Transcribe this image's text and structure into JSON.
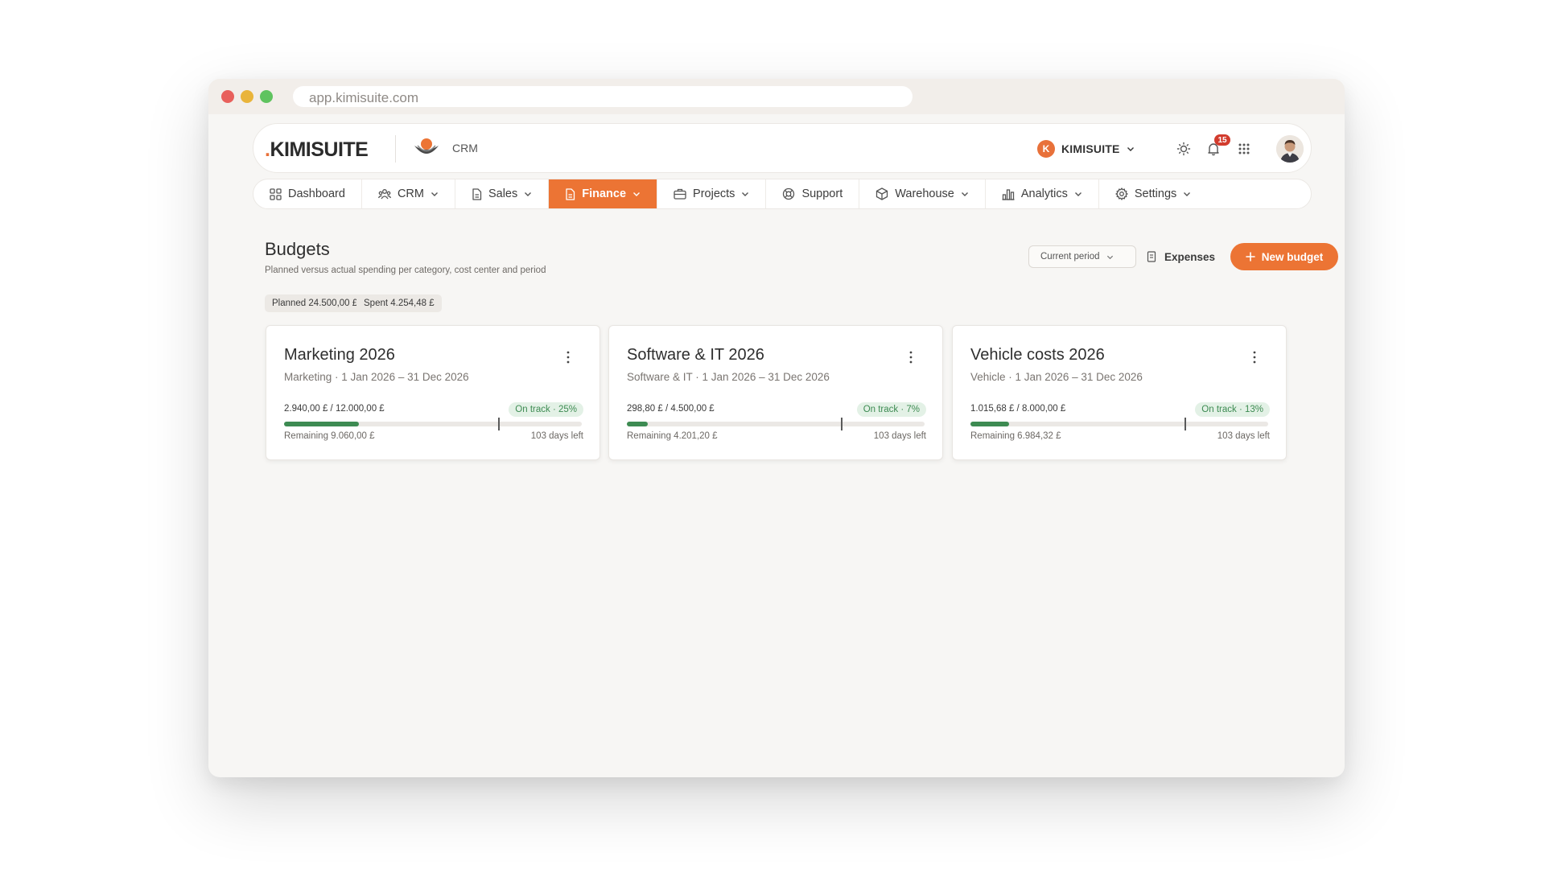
{
  "browser": {
    "url": "app.kimisuite.com"
  },
  "topbar": {
    "logo_text": "KIMISUITE",
    "app_label": "CRM",
    "org_initial": "K",
    "org_name": "KIMISUITE",
    "notifications_count": "15"
  },
  "nav": {
    "items": [
      {
        "label": "Dashboard",
        "icon": "grid-icon",
        "dropdown": false,
        "active": false
      },
      {
        "label": "CRM",
        "icon": "users-icon",
        "dropdown": true,
        "active": false
      },
      {
        "label": "Sales",
        "icon": "document-icon",
        "dropdown": true,
        "active": false
      },
      {
        "label": "Finance",
        "icon": "document-icon",
        "dropdown": true,
        "active": true
      },
      {
        "label": "Projects",
        "icon": "briefcase-icon",
        "dropdown": true,
        "active": false
      },
      {
        "label": "Support",
        "icon": "lifebuoy-icon",
        "dropdown": false,
        "active": false
      },
      {
        "label": "Warehouse",
        "icon": "box-icon",
        "dropdown": true,
        "active": false
      },
      {
        "label": "Analytics",
        "icon": "bar-chart-icon",
        "dropdown": true,
        "active": false
      },
      {
        "label": "Settings",
        "icon": "gear-icon",
        "dropdown": true,
        "active": false
      }
    ]
  },
  "page": {
    "title": "Budgets",
    "subtitle": "Planned versus actual spending per category, cost center and period",
    "summary": {
      "planned": "Planned 24.500,00 £",
      "spent": "Spent 4.254,48 £"
    },
    "actions": {
      "period_select": "Current period",
      "expenses_label": "Expenses",
      "new_budget_label": "New budget"
    }
  },
  "budgets": [
    {
      "title": "Marketing 2026",
      "meta": "Marketing · 1 Jan 2026 – 31 Dec 2026",
      "amount": "2.940,00 £ / 12.000,00 £",
      "status": "On track · 25%",
      "progress": 0.25,
      "time_elapsed": 0.72,
      "remaining": "Remaining 9.060,00 £",
      "days_left": "103 days left"
    },
    {
      "title": "Software & IT 2026",
      "meta": "Software & IT · 1 Jan 2026 – 31 Dec 2026",
      "amount": "298,80 £ / 4.500,00 £",
      "status": "On track · 7%",
      "progress": 0.07,
      "time_elapsed": 0.72,
      "remaining": "Remaining 4.201,20 £",
      "days_left": "103 days left"
    },
    {
      "title": "Vehicle costs 2026",
      "meta": "Vehicle · 1 Jan 2026 – 31 Dec 2026",
      "amount": "1.015,68 £ / 8.000,00 £",
      "status": "On track · 13%",
      "progress": 0.13,
      "time_elapsed": 0.72,
      "remaining": "Remaining 6.984,32 £",
      "days_left": "103 days left"
    }
  ],
  "colors": {
    "accent": "#ec7434",
    "success": "#3d8b52",
    "success_bg": "#e3f1e6",
    "danger": "#d23c2e"
  }
}
